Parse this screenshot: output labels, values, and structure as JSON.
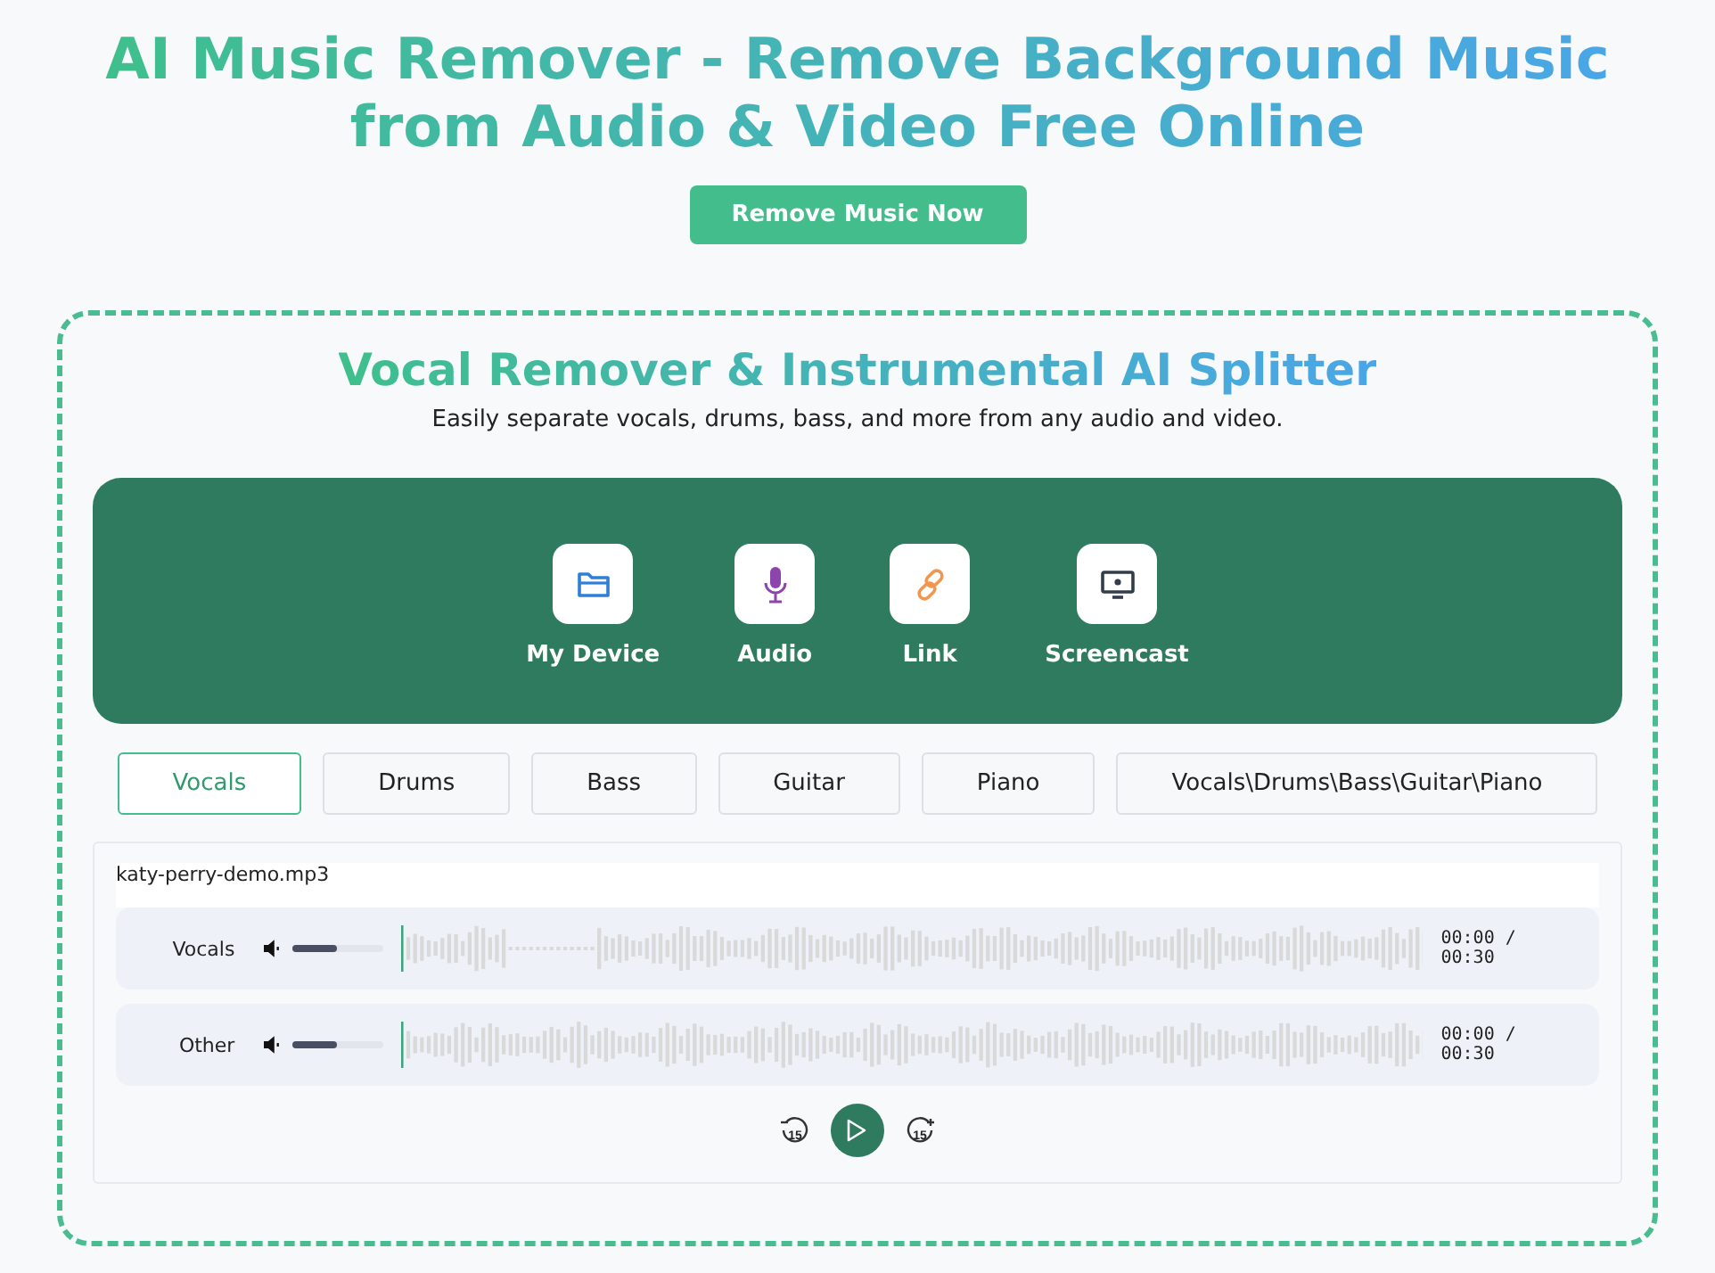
{
  "hero": {
    "title": "AI Music Remover - Remove Background Music from Audio & Video Free Online",
    "button": "Remove Music Now"
  },
  "tool": {
    "title": "Vocal Remover & Instrumental AI Splitter",
    "subtitle": "Easily separate vocals, drums, bass, and more from any audio and video.",
    "sources": [
      {
        "kind": "folder",
        "label": "My Device"
      },
      {
        "kind": "mic",
        "label": "Audio"
      },
      {
        "kind": "link",
        "label": "Link"
      },
      {
        "kind": "screen",
        "label": "Screencast"
      }
    ],
    "stems": [
      {
        "label": "Vocals",
        "selected": true
      },
      {
        "label": "Drums",
        "selected": false
      },
      {
        "label": "Bass",
        "selected": false
      },
      {
        "label": "Guitar",
        "selected": false
      },
      {
        "label": "Piano",
        "selected": false
      },
      {
        "label": "Vocals\\Drums\\Bass\\Guitar\\Piano",
        "selected": false
      }
    ],
    "player": {
      "file": "katy-perry-demo.mp3",
      "tracks": [
        {
          "name": "Vocals",
          "level": 0.5,
          "time": "00:00 / 00:30"
        },
        {
          "name": "Other",
          "level": 0.5,
          "time": "00:00 / 00:30"
        }
      ],
      "skip_back": "15",
      "skip_forward": "15"
    }
  }
}
